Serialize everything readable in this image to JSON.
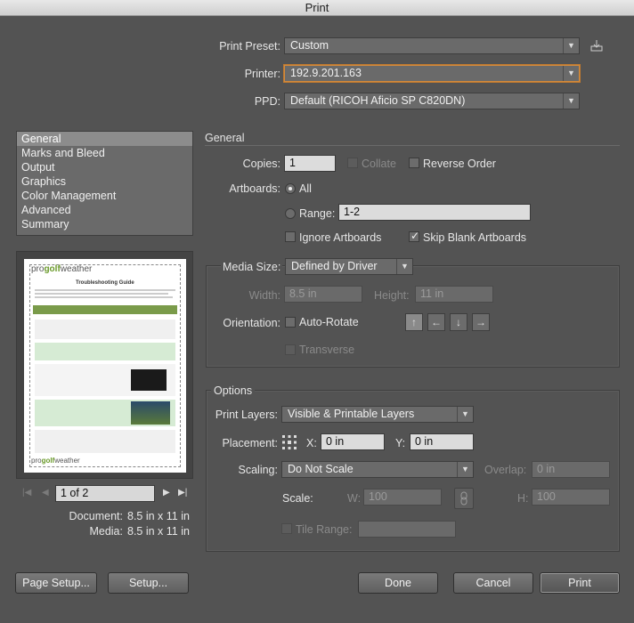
{
  "window": {
    "title": "Print"
  },
  "header": {
    "print_preset_label": "Print Preset:",
    "print_preset_value": "Custom",
    "printer_label": "Printer:",
    "printer_value": "192.9.201.163",
    "ppd_label": "PPD:",
    "ppd_value": "Default (RICOH Aficio SP C820DN)"
  },
  "sidebar": {
    "items": [
      {
        "label": "General",
        "selected": true
      },
      {
        "label": "Marks and Bleed"
      },
      {
        "label": "Output"
      },
      {
        "label": "Graphics"
      },
      {
        "label": "Color Management"
      },
      {
        "label": "Advanced"
      },
      {
        "label": "Summary"
      }
    ]
  },
  "preview": {
    "logo_pro": "pro",
    "logo_golf": "golf",
    "logo_weather": "weather",
    "doc_title": "Troubleshooting Guide",
    "page_indicator": "1 of 2",
    "document_label": "Document:",
    "document_value": "8.5 in x 11 in",
    "media_label": "Media:",
    "media_value": "8.5 in x 11 in"
  },
  "general": {
    "section_title": "General",
    "copies_label": "Copies:",
    "copies_value": "1",
    "collate_label": "Collate",
    "reverse_order_label": "Reverse Order",
    "artboards_label": "Artboards:",
    "all_label": "All",
    "range_label": "Range:",
    "range_value": "1-2",
    "ignore_artboards_label": "Ignore Artboards",
    "skip_blank_label": "Skip Blank Artboards"
  },
  "media": {
    "legend": "Media Size:",
    "size_value": "Defined by Driver",
    "width_label": "Width:",
    "width_value": "8.5 in",
    "height_label": "Height:",
    "height_value": "11 in",
    "orientation_label": "Orientation:",
    "auto_rotate_label": "Auto-Rotate",
    "transverse_label": "Transverse"
  },
  "options": {
    "legend": "Options",
    "print_layers_label": "Print Layers:",
    "print_layers_value": "Visible & Printable Layers",
    "placement_label": "Placement:",
    "x_label": "X:",
    "x_value": "0 in",
    "y_label": "Y:",
    "y_value": "0 in",
    "scaling_label": "Scaling:",
    "scaling_value": "Do Not Scale",
    "overlap_label": "Overlap:",
    "overlap_value": "0 in",
    "scale_label": "Scale:",
    "w_label": "W:",
    "w_value": "100",
    "h_label": "H:",
    "h_value": "100",
    "tile_range_label": "Tile Range:"
  },
  "footer": {
    "page_setup_label": "Page Setup...",
    "setup_label": "Setup...",
    "done_label": "Done",
    "cancel_label": "Cancel",
    "print_label": "Print"
  }
}
